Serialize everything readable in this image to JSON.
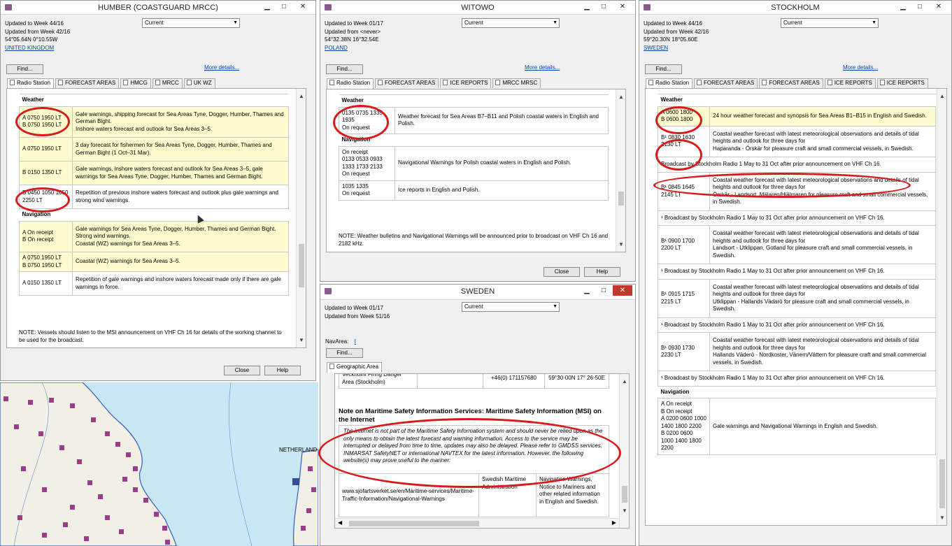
{
  "humber": {
    "title": "HUMBER (COASTGUARD MRCC)",
    "updated_to": "Updated to Week 44/16",
    "updated_from": "Updated from Week 42/16",
    "coords": "54°05.64N 0°10.55W",
    "country": "UNITED KINGDOM",
    "select": "Current",
    "find": "Find...",
    "more": "More details...",
    "tabs": [
      "Radio Station",
      "FORECAST AREAS",
      "HMCG",
      "MRCC",
      "UK WZ"
    ],
    "close": "Close",
    "help": "Help",
    "rows": [
      {
        "s": "Weather"
      },
      {
        "y": true,
        "t": "A 0750 1950 LT\nB 0750 1950 LT",
        "d": "Gale warnings, shipping forecast for Sea Areas Tyne, Dogger, Humber, Thames and German Bight.\nInshore waters forecast and outlook for Sea Areas 3–5."
      },
      {
        "y": true,
        "t": "A 0750 1950 LT",
        "d": "3 day forecast for fishermen for Sea Areas Tyne, Dogger, Humber, Thames and German Bight (1 Oct–31 Mar)."
      },
      {
        "y": true,
        "t": "B 0150 1350 LT",
        "d": "Gale warnings, inshore waters forecast and outlook for Sea Areas 3–5, gale warnings for Sea Areas Tyne, Dogger, Humber, Thames and German Bight."
      },
      {
        "y": false,
        "t": "B 0450 1050 1650 2250 LT",
        "d": "Repetition of previous inshore waters forecast and outlook plus gale warnings and strong wind warnings."
      },
      {
        "s": "Navigation"
      },
      {
        "y": true,
        "t": "A On receipt\nB On receipt",
        "d": "Gale warnings for Sea Areas Tyne, Dogger, Humber, Thames and German Bight.\nStrong wind warnings.\nCoastal (WZ) warnings for Sea Areas 3–5."
      },
      {
        "y": true,
        "t": "A 0750 1950 LT\nB 0750 1950 LT",
        "d": "Coastal (WZ) warnings for Sea Areas 3–5."
      },
      {
        "y": false,
        "t": "A 0150 1350 LT",
        "d": "Repetition of gale warnings and inshore waters forecast made only if there are gale warnings in force."
      }
    ],
    "note": "NOTE: Vessels should listen to the MSI announcement on VHF Ch 16 for details of the working channel to be used for the broadcast."
  },
  "witowo": {
    "title": "WITOWO",
    "updated_to": "Updated to Week 01/17",
    "updated_from": "Updated from <never>",
    "coords": "54°32.38N 16°32.54E",
    "country": "POLAND",
    "select": "Current",
    "find": "Find...",
    "more": "More details...",
    "tabs": [
      "Radio Station",
      "FORECAST AREAS",
      "ICE REPORTS",
      "MRCC MRSC"
    ],
    "close": "Close",
    "help": "Help",
    "rows": [
      {
        "s": "Weather"
      },
      {
        "y": false,
        "t": "0135 0735 1335 1935\nOn request",
        "d": "Weather forecast for Sea Areas B7–B11 and Polish coastal waters in English and Polish."
      },
      {
        "s": "Navigation"
      },
      {
        "y": false,
        "t": "On receipt\n0133 0533 0933 1333 1733 2133\nOn request",
        "d": "Navigational Warnings for Polish coastal waters in English and Polish."
      },
      {
        "y": false,
        "t": "1035 1335\nOn request",
        "d": "Ice reports in English and Polish."
      }
    ],
    "note": "NOTE: Weather bulletins and Navigational Warnings will be announced prior to broadcast on VHF Ch 16 and 2182 kHz."
  },
  "sweden": {
    "title": "SWEDEN",
    "updated_to": "Updated to Week 01/17",
    "updated_from": "Updated from Week 51/16",
    "select": "Current",
    "navarea_label": "NavArea:",
    "navarea_value": "I",
    "find": "Find...",
    "tab": "Geographic Area",
    "top_row": [
      "Veckholm Firing Danger Area (Stockholm)",
      "",
      "+46(0) 171157680",
      "59°30·00N 17° 26·50E"
    ],
    "heading": "Note on Maritime Safety Information Services: Maritime Safety Information (MSI) on the Internet",
    "para": "The internet is not part of the Maritime Safety Information system and should never be relied upon as the only means to obtain the latest forecast and warning information. Access to the service may be interrupted or delayed from time to time, updates may also be delayed. Please refer to GMDSS services, INMARSAT SafetyNET or international NAVTEX for the latest information. However, the following website(s) may prove useful to the mariner:",
    "web_row": [
      "www.sjofartsverket.se/en/Maritime-services/Maritime-Traffic-Information/Navigational-Warnings",
      "Swedish Maritime Administration",
      "Navigation Warnings, Notice to Mariners and other related information in English and Swedish."
    ]
  },
  "stockholm": {
    "title": "STOCKHOLM",
    "updated_to": "Updated to Week 44/16",
    "updated_from": "Updated from Week 42/16",
    "coords": "59°20.30N 18°05.60E",
    "country": "SWEDEN",
    "select": "Current",
    "find": "Find...",
    "more": "More details...",
    "tabs": [
      "Radio Station",
      "FORECAST AREAS",
      "FORECAST AREAS",
      "ICE REPORTS",
      "ICE REPORTS"
    ],
    "rows": [
      {
        "s": "Weather"
      },
      {
        "y": true,
        "t": "A 0600 1800\nB 0600 1800",
        "d": "24 hour weather forecast and synopsis for Sea Areas B1–B15 in English and Swedish."
      },
      {
        "y": false,
        "t": "B¹ 0830 1630 2130 LT",
        "d": "Coastal weather forecast with latest meteorological observations and details of tidal heights and outlook for three days for\nHaparanda - Örskär for pleasure craft and small commercial vessels, in Swedish."
      },
      {
        "f": "Broadcast by Stockholm Radio 1 May to 31 Oct after prior announcement on VHF Ch 16."
      },
      {
        "y": false,
        "t": "B¹ 0845 1645 2145 LT",
        "d": "Coastal weather forecast with latest meteorological observations and details of tidal heights and outlook for three days for\nÖrskär - Landsort, Mälaren/Hjälmaren for pleasure craft and small commercial vessels, in Swedish."
      },
      {
        "f": "¹ Broadcast by Stockholm Radio 1 May to 31 Oct after prior announcement on VHF Ch 16."
      },
      {
        "y": false,
        "t": "B¹ 0900 1700 2200 LT",
        "d": "Coastal weather forecast with latest meteorological observations and details of tidal heights and outlook for three days for\nLandsort - Utklippan, Gotland for pleasure craft and small commercial vessels, in Swedish."
      },
      {
        "f": "¹ Broadcast by Stockholm Radio 1 May to 31 Oct after prior announcement on VHF Ch 16."
      },
      {
        "y": false,
        "t": "B¹ 0915 1715 2215 LT",
        "d": "Coastal weather forecast with latest meteorological observations and details of tidal heights and outlook for three days for\nUtklippan - Hallands Vädarö for pleasure craft and small commercial vessels, in Swedish."
      },
      {
        "f": "¹ Broadcast by Stockholm Radio 1 May to 31 Oct after prior announcement on VHF Ch 16."
      },
      {
        "y": false,
        "t": "B¹ 0930 1730 2230 LT",
        "d": "Coastal weather forecast with latest meteorological observations and details of tidal heights and outlook for three days for\nHallands Väderö - Nordkoster, Vänern/Vättern for pleasure craft and small commercial vessels, in Swedish."
      },
      {
        "f": "¹ Broadcast by Stockholm Radio 1 May to 31 Oct after prior announcement on VHF Ch 16."
      },
      {
        "s": "Navigation"
      },
      {
        "y": false,
        "t": "A On receipt\nB On receipt\nA 0200 0600 1000 1400 1800 2200\nB 0200 0600 1000 1400 1800 2200",
        "d": "Gale warnings and Navigational Warnings in English and Swedish."
      }
    ]
  },
  "map": {
    "label": "NETHERLAND",
    "colors": {
      "sea": "#c9e6f5",
      "land": "#f2efe6",
      "coast": "#2b5fb5",
      "station": "#9b3d8a"
    }
  }
}
